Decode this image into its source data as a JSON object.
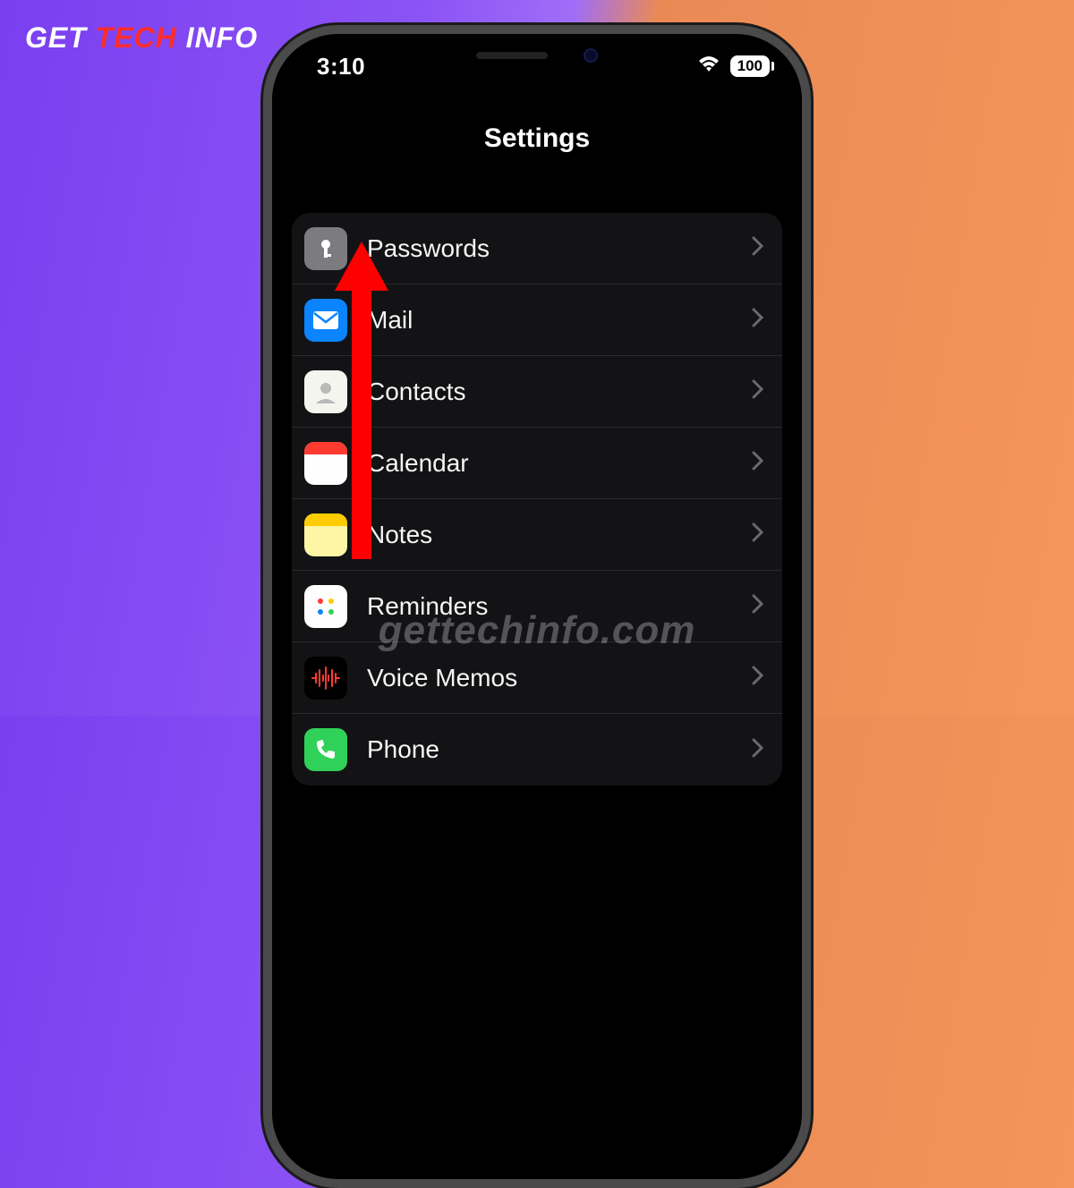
{
  "brand": {
    "p1": "GET ",
    "p2": "TECH ",
    "p3": "INFO"
  },
  "status": {
    "time": "3:10",
    "battery": "100"
  },
  "nav_title": "Settings",
  "rows": [
    {
      "label": "Passwords",
      "icon": "key-icon"
    },
    {
      "label": "Mail",
      "icon": "mail-icon"
    },
    {
      "label": "Contacts",
      "icon": "contacts-icon"
    },
    {
      "label": "Calendar",
      "icon": "calendar-icon"
    },
    {
      "label": "Notes",
      "icon": "notes-icon"
    },
    {
      "label": "Reminders",
      "icon": "reminders-icon"
    },
    {
      "label": "Voice Memos",
      "icon": "voice-memos-icon"
    },
    {
      "label": "Phone",
      "icon": "phone-icon"
    }
  ],
  "watermark": "gettechinfo.com"
}
